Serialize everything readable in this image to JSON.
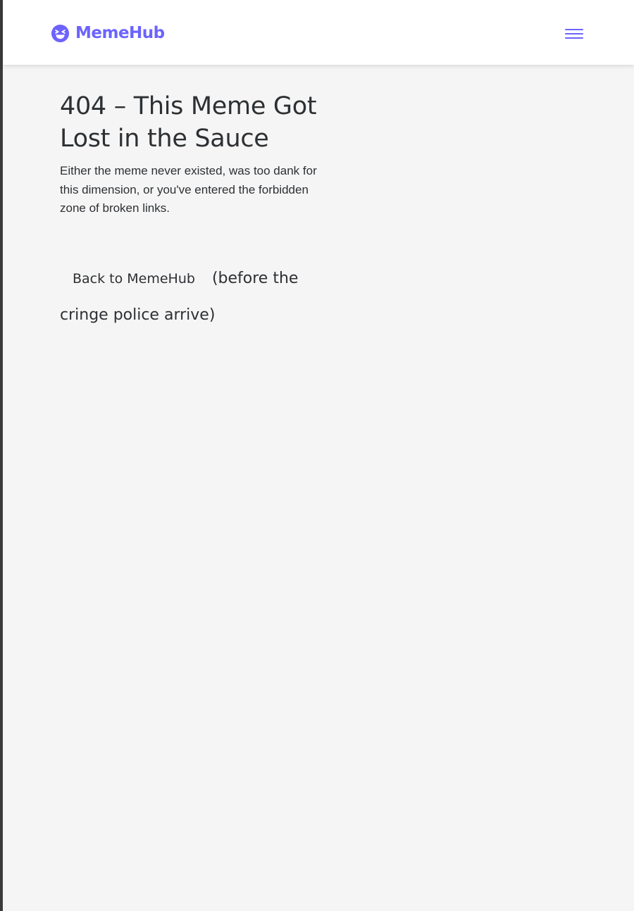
{
  "brand": {
    "name": "MemeHub",
    "icon": "laughing-face-icon",
    "color": "#6c63ff"
  },
  "nav": {
    "menu_icon": "hamburger-menu-icon"
  },
  "error": {
    "title": "404 – This Meme Got Lost in the Sauce",
    "description": "Either the meme never existed, was too dank for this dimension, or you've entered the forbidden zone of broken links.",
    "back_button_label": "Back to MemeHub",
    "back_suffix": "(before the cringe police arrive)"
  }
}
